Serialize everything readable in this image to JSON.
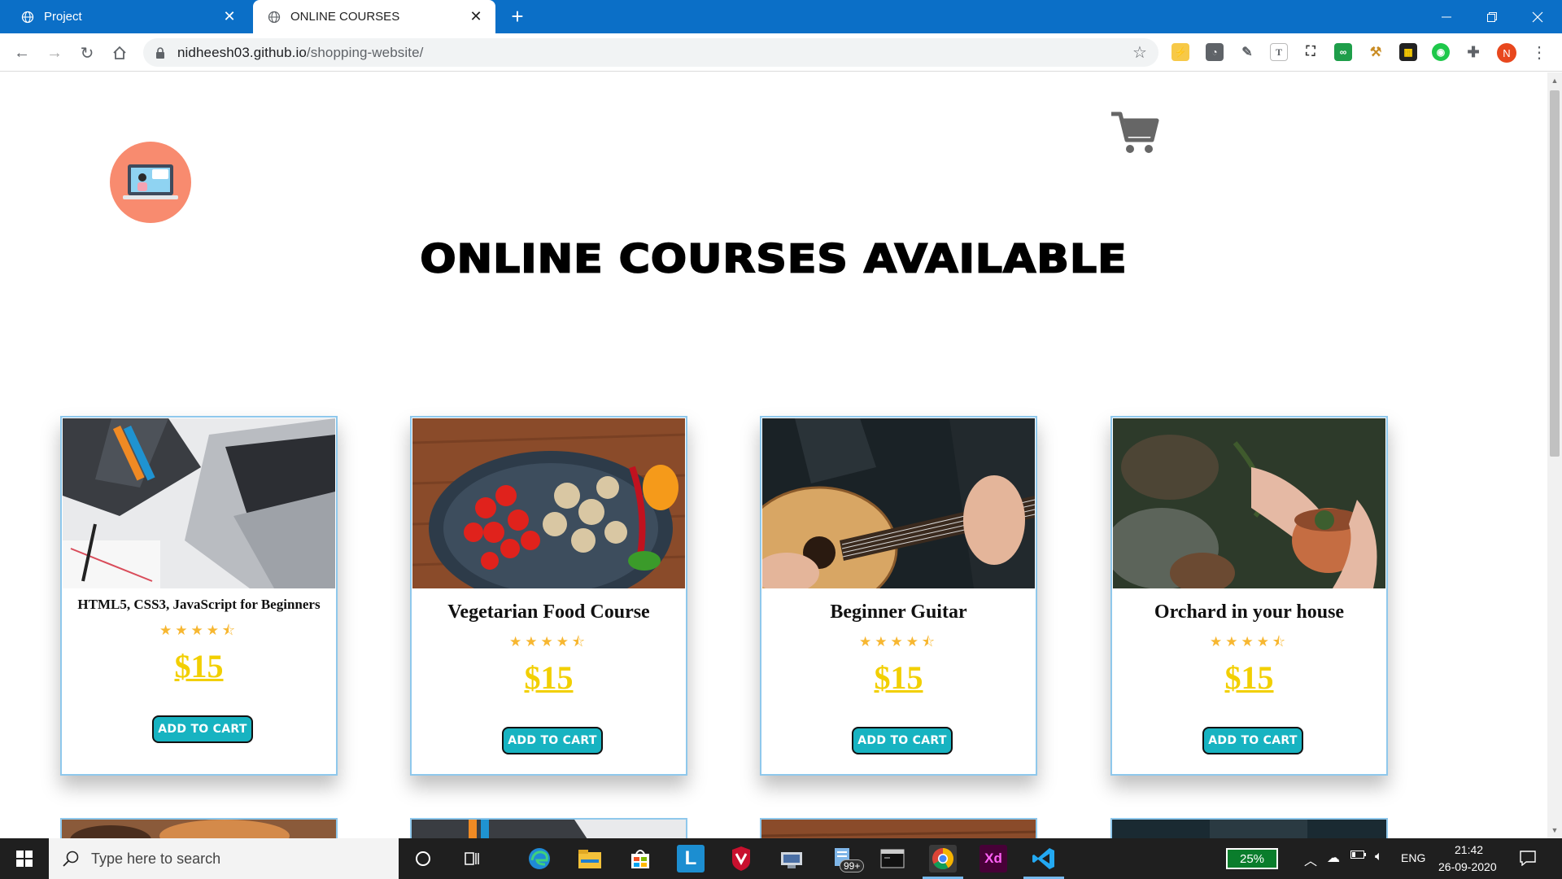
{
  "browser": {
    "tabs": [
      {
        "title": "Project",
        "active": false
      },
      {
        "title": "ONLINE COURSES",
        "active": true
      }
    ],
    "url_domain": "nidheesh03.github.io",
    "url_path": "/shopping-website/",
    "profile_initial": "N"
  },
  "page": {
    "title": "ONLINE COURSES AVAILABLE",
    "courses": [
      {
        "name": "HTML5, CSS3, JavaScript for Beginners",
        "rating": 4.5,
        "stars": "★★★★⯪",
        "price": "$15",
        "button": "ADD TO CART"
      },
      {
        "name": "Vegetarian Food Course",
        "rating": 4.5,
        "stars": "★★★★⯪",
        "price": "$15",
        "button": "ADD TO CART"
      },
      {
        "name": "Beginner Guitar",
        "rating": 4.5,
        "stars": "★★★★⯪",
        "price": "$15",
        "button": "ADD TO CART"
      },
      {
        "name": "Orchard in your house",
        "rating": 4.5,
        "stars": "★★★★⯪",
        "price": "$15",
        "button": "ADD TO CART"
      }
    ]
  },
  "taskbar": {
    "search_placeholder": "Type here to search",
    "notification_count": "99+",
    "battery": "25%",
    "language": "ENG",
    "time": "21:42",
    "date": "26-09-2020"
  },
  "colors": {
    "tabstrip": "#0b6fc7",
    "card_border": "#8fc8ec",
    "price": "#f2cf00",
    "star": "#f7b731",
    "button": "#17b3c1",
    "logo_circle": "#f88b6f"
  }
}
